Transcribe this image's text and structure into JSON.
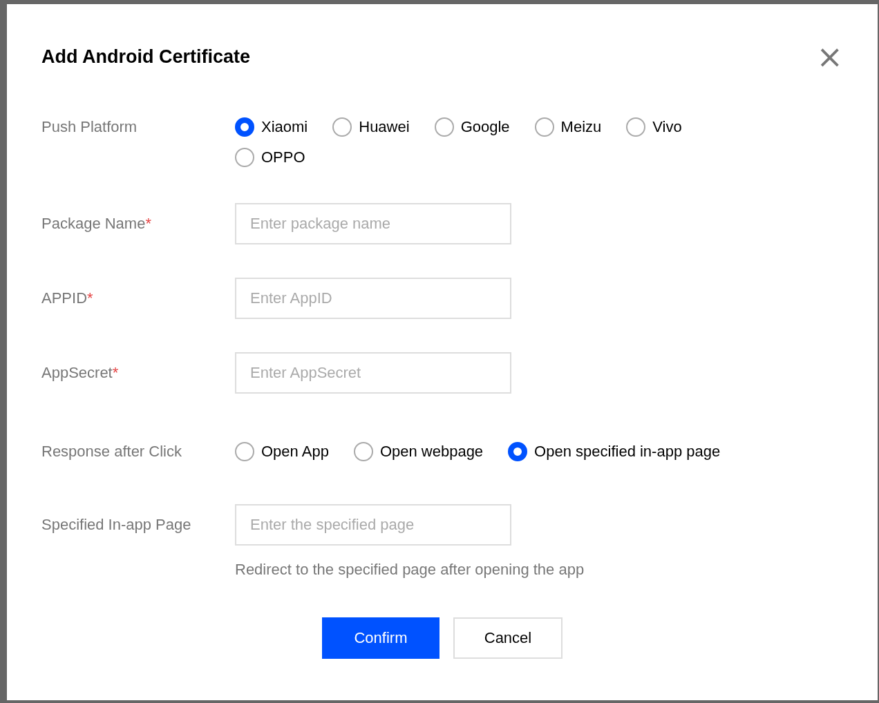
{
  "dialog": {
    "title": "Add Android Certificate",
    "close_icon": "×",
    "push_platform": {
      "label": "Push Platform",
      "options": [
        {
          "label": "Xiaomi",
          "selected": true
        },
        {
          "label": "Huawei",
          "selected": false
        },
        {
          "label": "Google",
          "selected": false
        },
        {
          "label": "Meizu",
          "selected": false
        },
        {
          "label": "Vivo",
          "selected": false
        },
        {
          "label": "OPPO",
          "selected": false
        }
      ]
    },
    "fields": [
      {
        "label": "Package Name",
        "required_mark": "*",
        "placeholder": "Enter package name"
      },
      {
        "label": "APPID",
        "required_mark": "*",
        "placeholder": "Enter AppID"
      },
      {
        "label": "AppSecret",
        "required_mark": "*",
        "placeholder": "Enter AppSecret"
      }
    ],
    "response": {
      "label": "Response after Click",
      "options": [
        {
          "label": "Open App",
          "selected": false
        },
        {
          "label": "Open webpage",
          "selected": false
        },
        {
          "label": "Open specified in-app page",
          "selected": true
        }
      ]
    },
    "in_app_page": {
      "label": "Specified In-app Page",
      "placeholder": "Enter the specified page",
      "hint": "Redirect to the specified page after opening the app"
    },
    "buttons": [
      {
        "label": "Confirm",
        "kind": "primary"
      },
      {
        "label": "Cancel",
        "kind": "secondary"
      }
    ]
  }
}
